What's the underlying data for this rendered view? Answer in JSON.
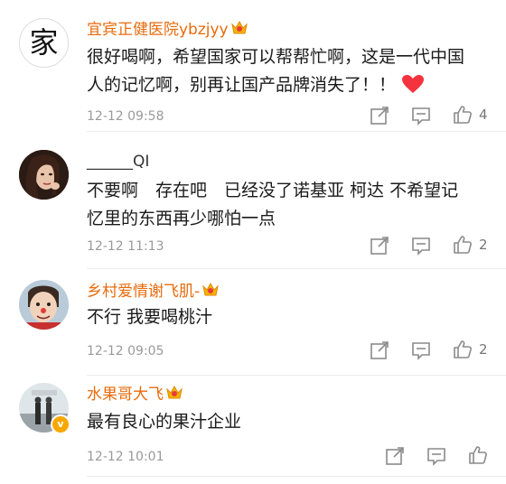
{
  "comments": [
    {
      "name": "宜宾正健医院ybzjyy",
      "avatar_char": "家",
      "text_lines": [
        "很好喝啊，希望国家可以帮帮忙啊，这是一代中国",
        "人的记忆啊，别再让国产品牌消失了！！"
      ],
      "time": "12-12 09:58",
      "likes": "4"
    },
    {
      "name": "______QI",
      "text_lines": [
        "不要啊　存在吧　已经没了诺基亚 柯达 不希望记",
        "忆里的东西再少哪怕一点"
      ],
      "time": "12-12 11:13",
      "likes": "2"
    },
    {
      "name": "乡村爱情谢飞肌-",
      "text_lines": [
        "不行 我要喝桃汁"
      ],
      "time": "12-12 09:05",
      "likes": "2"
    },
    {
      "name": "水果哥大飞",
      "avatar_badge": "v",
      "text_lines": [
        "最有良心的果汁企业"
      ],
      "time": "12-12 10:01",
      "likes": ""
    }
  ],
  "colors": {
    "vip_name": "#e86b0c",
    "heart": "#f5333f",
    "icon": "#8a8a8a"
  },
  "icons": [
    "share-icon",
    "comment-icon",
    "like-icon",
    "heart-icon",
    "crown-badge-icon"
  ]
}
